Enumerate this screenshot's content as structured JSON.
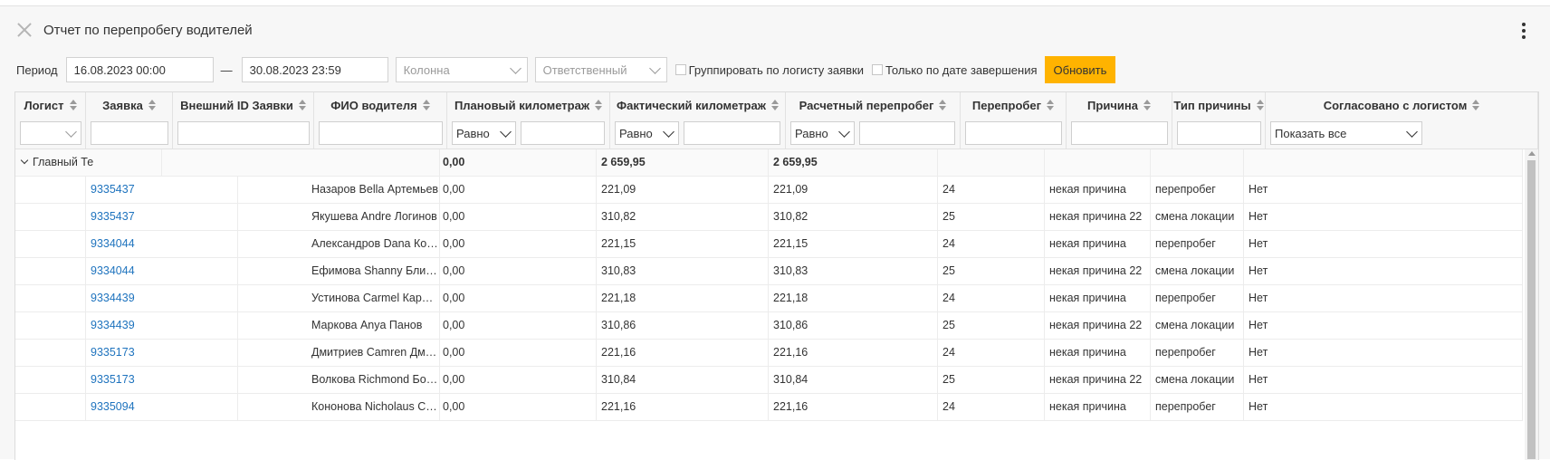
{
  "title": "Отчет по перепробегу водителей",
  "filters": {
    "period_label": "Период",
    "date_from": "16.08.2023 00:00",
    "separator": "—",
    "date_to": "30.08.2023 23:59",
    "column_placeholder": "Колонна",
    "responsible_placeholder": "Ответственный",
    "group_by_logist_label": "Группировать по логисту заявки",
    "only_completion_date_label": "Только по дате завершения",
    "refresh_label": "Обновить"
  },
  "columns": [
    "Логист",
    "Заявка",
    "Внешний ID Заявки",
    "ФИО водителя",
    "Плановый километраж",
    "Фактический километраж",
    "Расчетный перепробег",
    "Перепробег",
    "Причина",
    "Тип причины",
    "Согласовано с логистом"
  ],
  "filter_row": {
    "equal_label": "Равно",
    "show_all_label": "Показать все"
  },
  "group_row": {
    "name": "Главный Те",
    "plan": "0,00",
    "fact": "2 659,95",
    "calc": "2 659,95"
  },
  "rows": [
    {
      "order": "9335437",
      "driver": "Назаров Bella Артемьев",
      "plan": "0,00",
      "fact": "221,09",
      "calc": "221,09",
      "over": "24",
      "reason": "некая причина",
      "reason_type": "перепробег",
      "agreed": "Нет"
    },
    {
      "order": "9335437",
      "driver": "Якушева Andre Логинов",
      "plan": "0,00",
      "fact": "310,82",
      "calc": "310,82",
      "over": "25",
      "reason": "некая причина 22",
      "reason_type": "смена локации",
      "agreed": "Нет"
    },
    {
      "order": "9334044",
      "driver": "Александров Dana Ковалев",
      "plan": "0,00",
      "fact": "221,15",
      "calc": "221,15",
      "over": "24",
      "reason": "некая причина",
      "reason_type": "перепробег",
      "agreed": "Нет"
    },
    {
      "order": "9334044",
      "driver": "Ефимова Shanny Блинова",
      "plan": "0,00",
      "fact": "310,83",
      "calc": "310,83",
      "over": "25",
      "reason": "некая причина 22",
      "reason_type": "смена локации",
      "agreed": "Нет"
    },
    {
      "order": "9334439",
      "driver": "Устинова Carmel Карпова",
      "plan": "0,00",
      "fact": "221,18",
      "calc": "221,18",
      "over": "24",
      "reason": "некая причина",
      "reason_type": "перепробег",
      "agreed": "Нет"
    },
    {
      "order": "9334439",
      "driver": "Маркова Anya Панов",
      "plan": "0,00",
      "fact": "310,86",
      "calc": "310,86",
      "over": "25",
      "reason": "некая причина 22",
      "reason_type": "смена локации",
      "agreed": "Нет"
    },
    {
      "order": "9335173",
      "driver": "Дмитриев Camren Дмитриев",
      "plan": "0,00",
      "fact": "221,16",
      "calc": "221,16",
      "over": "24",
      "reason": "некая причина",
      "reason_type": "перепробег",
      "agreed": "Нет"
    },
    {
      "order": "9335173",
      "driver": "Волкова Richmond Борисов",
      "plan": "0,00",
      "fact": "310,84",
      "calc": "310,84",
      "over": "25",
      "reason": "некая причина 22",
      "reason_type": "смена локации",
      "agreed": "Нет"
    },
    {
      "order": "9335094",
      "driver": "Кононова Nicholaus Соколов",
      "plan": "0,00",
      "fact": "221,16",
      "calc": "221,16",
      "over": "24",
      "reason": "некая причина",
      "reason_type": "перепробег",
      "agreed": "Нет"
    }
  ]
}
